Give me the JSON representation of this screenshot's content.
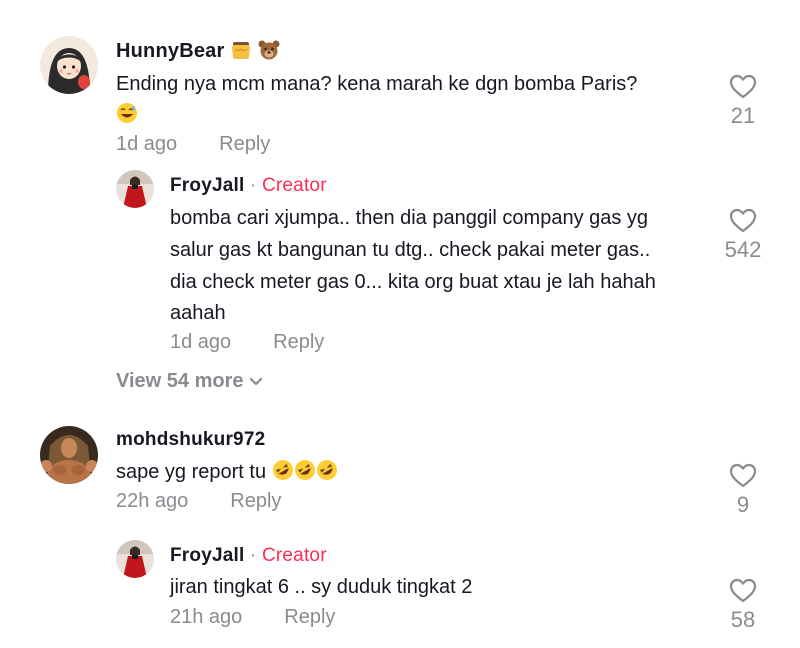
{
  "comments": [
    {
      "username": "HunnyBear",
      "username_emojis": [
        "honey-pot-icon",
        "bear-face-icon"
      ],
      "text_line1": "Ending nya mcm mana? kena marah ke dgn bomba Paris?",
      "text_line2_emoji": "sweat-smile-icon",
      "time": "1d ago",
      "reply_label": "Reply",
      "likes": "21",
      "reply": {
        "username": "FroyJall",
        "separator": "·",
        "badge": "Creator",
        "lines": [
          "bomba cari xjumpa.. then dia panggil company gas yg",
          "salur gas kt bangunan tu dtg.. check pakai meter gas..",
          "dia check meter gas 0... kita org buat xtau je lah hahah",
          "aahah"
        ],
        "time": "1d ago",
        "reply_label": "Reply",
        "likes": "542"
      },
      "view_more": "View 54 more"
    },
    {
      "username": "mohdshukur972",
      "text": "sape yg report tu",
      "text_emojis": [
        "rofl-icon",
        "rofl-icon",
        "rofl-icon"
      ],
      "time": "22h ago",
      "reply_label": "Reply",
      "likes": "9",
      "reply": {
        "username": "FroyJall",
        "separator": "·",
        "badge": "Creator",
        "text": "jiran tingkat 6 .. sy duduk tingkat 2",
        "time": "21h ago",
        "reply_label": "Reply",
        "likes": "58"
      }
    }
  ],
  "colors": {
    "text": "#161823",
    "secondary": "#8a8b91",
    "creator": "#fe2c55"
  }
}
